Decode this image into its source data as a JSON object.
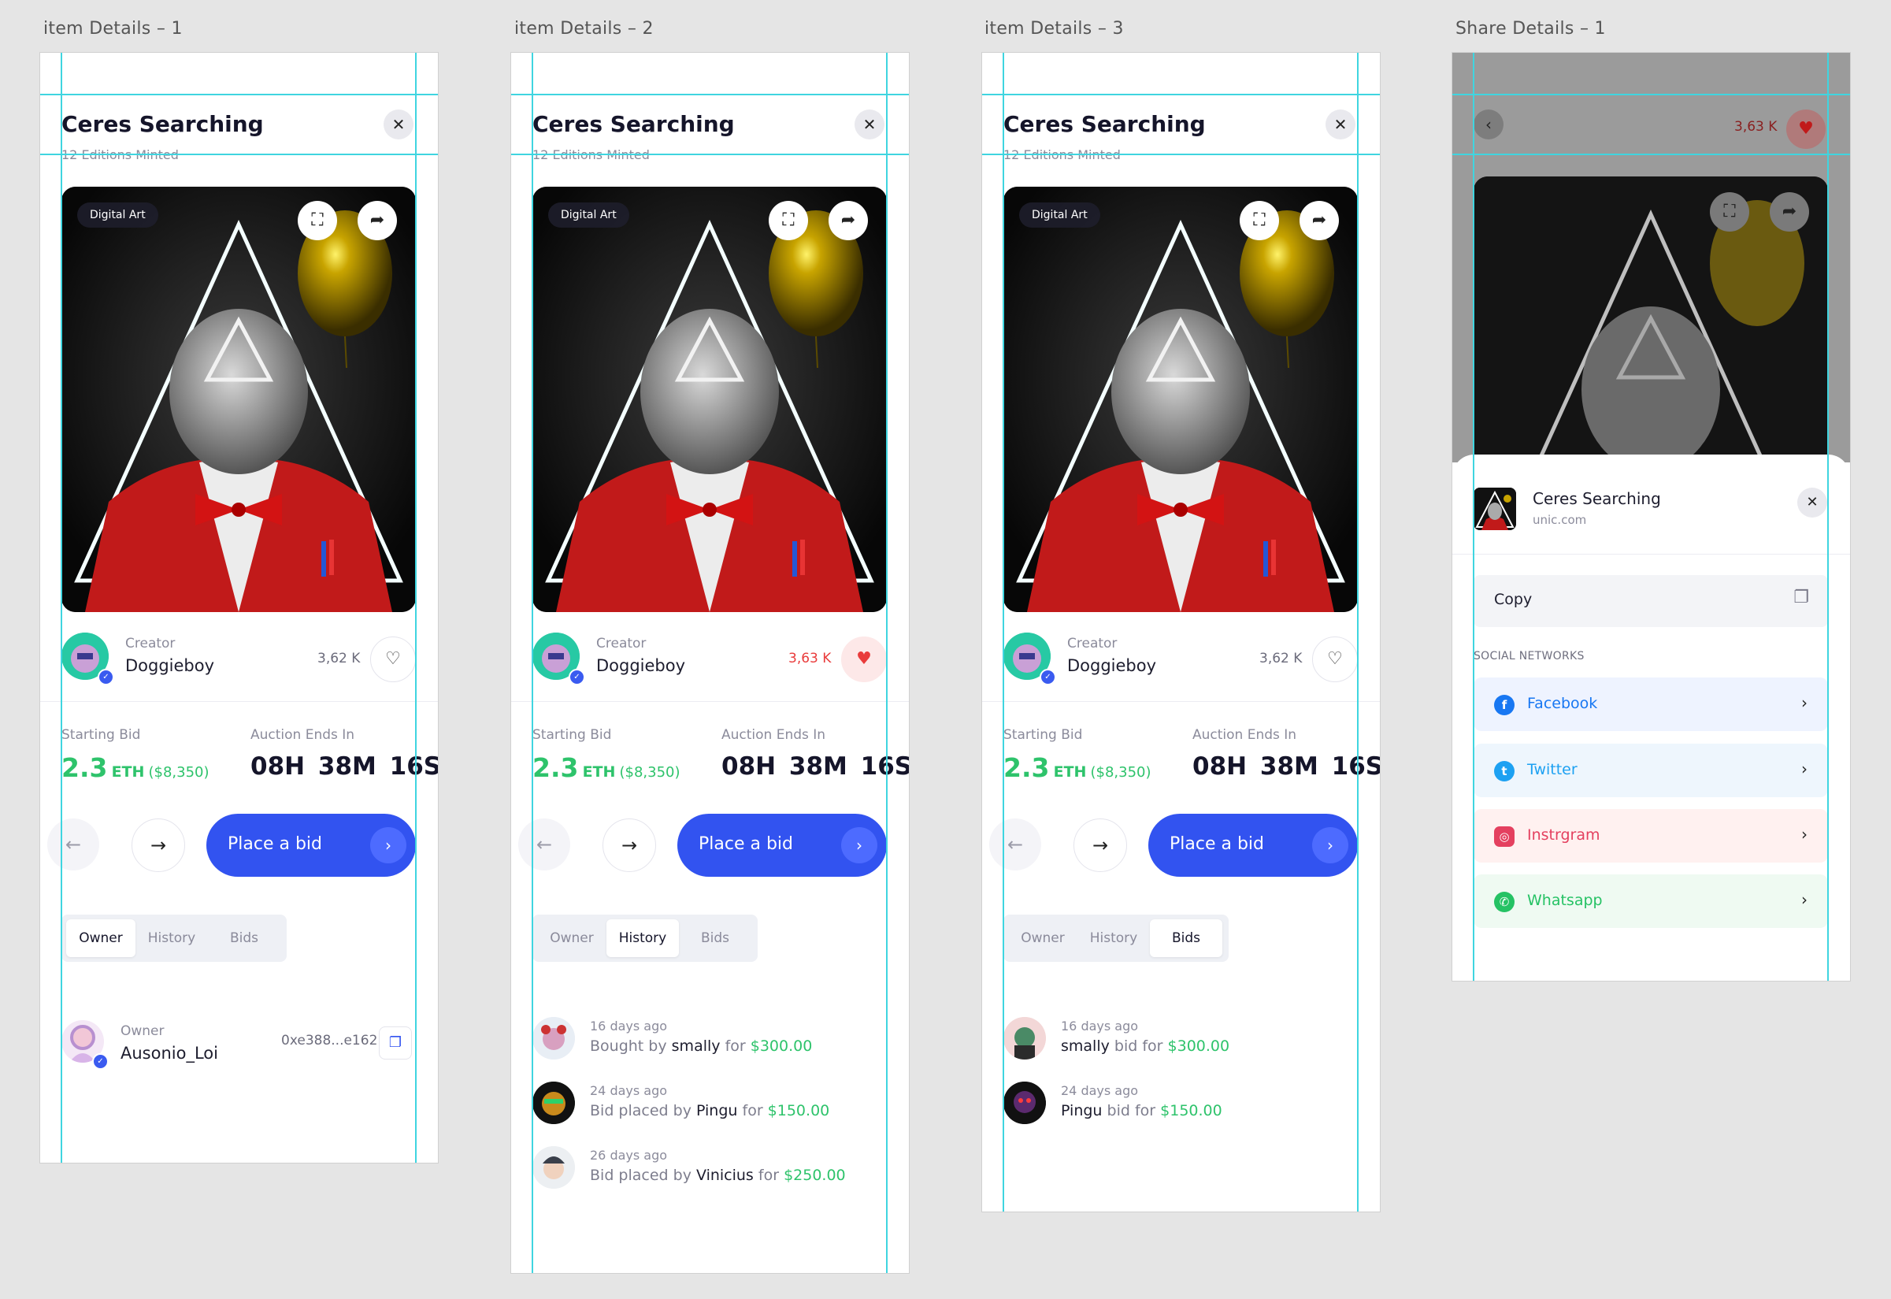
{
  "frames": [
    {
      "label": "item Details – 1",
      "title": "Ceres Searching",
      "subtitle": "12 Editions Minted",
      "close": "✕",
      "badge": "Digital Art",
      "creator_label": "Creator",
      "creator_name": "Doggieboy",
      "likes": "3,62 K",
      "liked": false,
      "starting_bid_label": "Starting Bid",
      "auction_label": "Auction Ends In",
      "bid_amount": "2.3",
      "bid_currency": "ETH",
      "bid_usd": "($8,350)",
      "countdown": "08H 38M 16S",
      "cta": "Place a bid",
      "tabs": [
        "Owner",
        "History",
        "Bids"
      ],
      "active_tab": "Owner",
      "owner": {
        "label": "Owner",
        "name": "Ausonio_Loi",
        "address": "0xe388...e162"
      }
    },
    {
      "label": "item Details – 2",
      "title": "Ceres Searching",
      "subtitle": "12 Editions Minted",
      "close": "✕",
      "badge": "Digital Art",
      "creator_label": "Creator",
      "creator_name": "Doggieboy",
      "likes": "3,63 K",
      "liked": true,
      "starting_bid_label": "Starting Bid",
      "auction_label": "Auction Ends In",
      "bid_amount": "2.3",
      "bid_currency": "ETH",
      "bid_usd": "($8,350)",
      "countdown": "08H 38M 16S",
      "cta": "Place a bid",
      "tabs": [
        "Owner",
        "History",
        "Bids"
      ],
      "active_tab": "History",
      "history": [
        {
          "time": "16 days ago",
          "pre": "Bought by",
          "who": "smally",
          "mid": "for",
          "amount": "$300.00"
        },
        {
          "time": "24 days ago",
          "pre": "Bid placed by",
          "who": "Pingu",
          "mid": "for",
          "amount": "$150.00"
        },
        {
          "time": "26 days ago",
          "pre": "Bid placed by",
          "who": "Vinicius",
          "mid": "for",
          "amount": "$250.00"
        }
      ]
    },
    {
      "label": "item Details – 3",
      "title": "Ceres Searching",
      "subtitle": "12 Editions Minted",
      "close": "✕",
      "badge": "Digital Art",
      "creator_label": "Creator",
      "creator_name": "Doggieboy",
      "likes": "3,62 K",
      "liked": false,
      "starting_bid_label": "Starting Bid",
      "auction_label": "Auction Ends In",
      "bid_amount": "2.3",
      "bid_currency": "ETH",
      "bid_usd": "($8,350)",
      "countdown": "08H 38M 16S",
      "cta": "Place a bid",
      "tabs": [
        "Owner",
        "History",
        "Bids"
      ],
      "active_tab": "Bids",
      "bids": [
        {
          "time": "16 days ago",
          "who": "smally",
          "mid": "bid for",
          "amount": "$300.00"
        },
        {
          "time": "24 days ago",
          "who": "Pingu",
          "mid": "bid for",
          "amount": "$150.00"
        }
      ]
    }
  ],
  "share": {
    "label": "Share Details – 1",
    "likes": "3,63 K",
    "item_title": "Ceres Searching",
    "item_domain": "unic.com",
    "copy_label": "Copy",
    "section_label": "SOCIAL NETWORKS",
    "networks": [
      {
        "name": "Facebook",
        "color": "#1877f2",
        "bg": "#eef3ff",
        "glyph": "f"
      },
      {
        "name": "Twitter",
        "color": "#1da1f2",
        "bg": "#eef6fd",
        "glyph": "t"
      },
      {
        "name": "Instrgram",
        "color": "#e4405f",
        "bg": "#fff1f0",
        "glyph": "◎"
      },
      {
        "name": "Whatsapp",
        "color": "#25c264",
        "bg": "#effaf2",
        "glyph": "✆"
      }
    ]
  },
  "colors": {
    "accent": "#3253f0",
    "green": "#2ec36b",
    "red": "#e93b3b",
    "guide": "#3fd5e0"
  },
  "icons": [
    "close-icon",
    "expand-icon",
    "share-icon",
    "heart-icon",
    "arrow-left-icon",
    "arrow-right-icon",
    "chevron-right-icon",
    "copy-icon",
    "verified-icon"
  ]
}
